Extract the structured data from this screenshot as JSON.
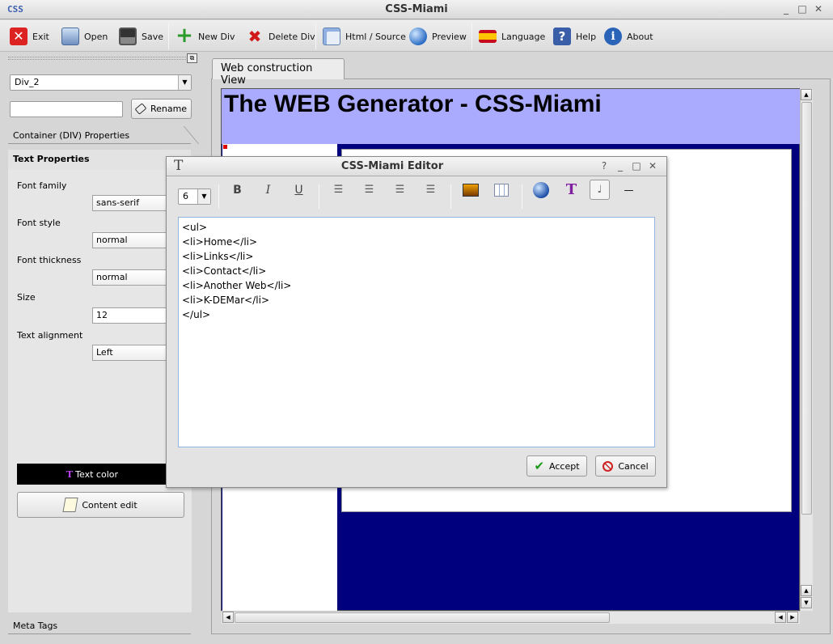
{
  "app": {
    "logo": "CSS",
    "title": "CSS-Miami",
    "window_controls": [
      "_",
      "□",
      "✕"
    ]
  },
  "toolbar": {
    "items": [
      {
        "label": "Exit",
        "icon": "exit-icon"
      },
      {
        "label": "Open",
        "icon": "open-icon"
      },
      {
        "label": "Save",
        "icon": "save-icon"
      },
      {
        "label": "New Div",
        "icon": "new-div-icon"
      },
      {
        "label": "Delete Div",
        "icon": "delete-div-icon"
      },
      {
        "label": "Html / Source",
        "icon": "html-source-icon"
      },
      {
        "label": "Preview",
        "icon": "preview-icon"
      },
      {
        "label": "Language",
        "icon": "language-flag-icon"
      },
      {
        "label": "Help",
        "icon": "help-icon"
      },
      {
        "label": "About",
        "icon": "about-icon"
      }
    ]
  },
  "left_panel": {
    "div_select": "Div_2",
    "rename_input": "",
    "rename_label": "Rename",
    "container_tab": "Container (DIV) Properties",
    "text_tab": "Text Properties",
    "font_family_label": "Font family",
    "font_family_value": "sans-serif",
    "font_style_label": "Font style",
    "font_style_value": "normal",
    "font_thickness_label": "Font thickness",
    "font_thickness_value": "normal",
    "size_label": "Size",
    "size_value": "12",
    "text_alignment_label": "Text alignment",
    "text_alignment_value": "Left",
    "text_color_label": "Text color",
    "content_edit_label": "Content edit",
    "meta_tab": "Meta Tags"
  },
  "workspace": {
    "tab_label": "Web construction View",
    "header_text": "The WEB Generator - CSS-Miami",
    "colors": {
      "header_bg": "#aaaaff",
      "page_bg": "#00007f"
    }
  },
  "dialog": {
    "title": "CSS-Miami Editor",
    "controls": [
      "?",
      "_",
      "□",
      "✕"
    ],
    "font_size_value": "6",
    "editor_text": "<ul>\n<li>Home</li>\n<li>Links</li>\n<li>Contact</li>\n<li>Another Web</li>\n<li>K-DEMar</li>\n</ul>",
    "accept_label": "Accept",
    "cancel_label": "Cancel",
    "format_buttons": [
      "B",
      "I",
      "U"
    ],
    "hr_label": "—"
  }
}
